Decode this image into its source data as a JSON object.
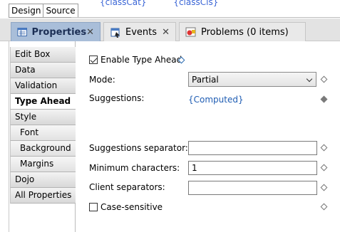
{
  "editor": {
    "cut_text": [
      "{classCat}",
      "{classCls}"
    ],
    "mode_tabs": [
      "Design",
      "Source"
    ]
  },
  "view_tabs": [
    {
      "label": "Properties",
      "icon": "properties-icon",
      "active": true
    },
    {
      "label": "Events",
      "icon": "events-icon",
      "active": false
    },
    {
      "label": "Problems (0 items)",
      "icon": "problems-icon",
      "active": false
    }
  ],
  "close_glyph": "✕",
  "left_tabs": [
    {
      "label": "Edit Box",
      "sub": false,
      "selected": false
    },
    {
      "label": "Data",
      "sub": false,
      "selected": false
    },
    {
      "label": "Validation",
      "sub": false,
      "selected": false
    },
    {
      "label": "Type Ahead",
      "sub": false,
      "selected": true
    },
    {
      "label": "Style",
      "sub": false,
      "selected": false
    },
    {
      "label": "Font",
      "sub": true,
      "selected": false
    },
    {
      "label": "Background",
      "sub": true,
      "selected": false
    },
    {
      "label": "Margins",
      "sub": true,
      "selected": false
    },
    {
      "label": "Dojo",
      "sub": false,
      "selected": false
    },
    {
      "label": "All Properties",
      "sub": false,
      "selected": false
    }
  ],
  "form": {
    "enable_type_ahead": {
      "label": "Enable Type Ahead",
      "checked": true
    },
    "mode": {
      "label": "Mode:",
      "value": "Partial"
    },
    "suggestions": {
      "label": "Suggestions:",
      "value": "{Computed}"
    },
    "suggestions_separator": {
      "label": "Suggestions separator:",
      "value": ""
    },
    "minimum_characters": {
      "label": "Minimum characters:",
      "value": "1"
    },
    "client_separators": {
      "label": "Client separators:",
      "value": ""
    },
    "case_sensitive": {
      "label": "Case-sensitive",
      "checked": false
    }
  },
  "colors": {
    "active_tab": "#a9bed9",
    "link": "#1f5db3"
  }
}
